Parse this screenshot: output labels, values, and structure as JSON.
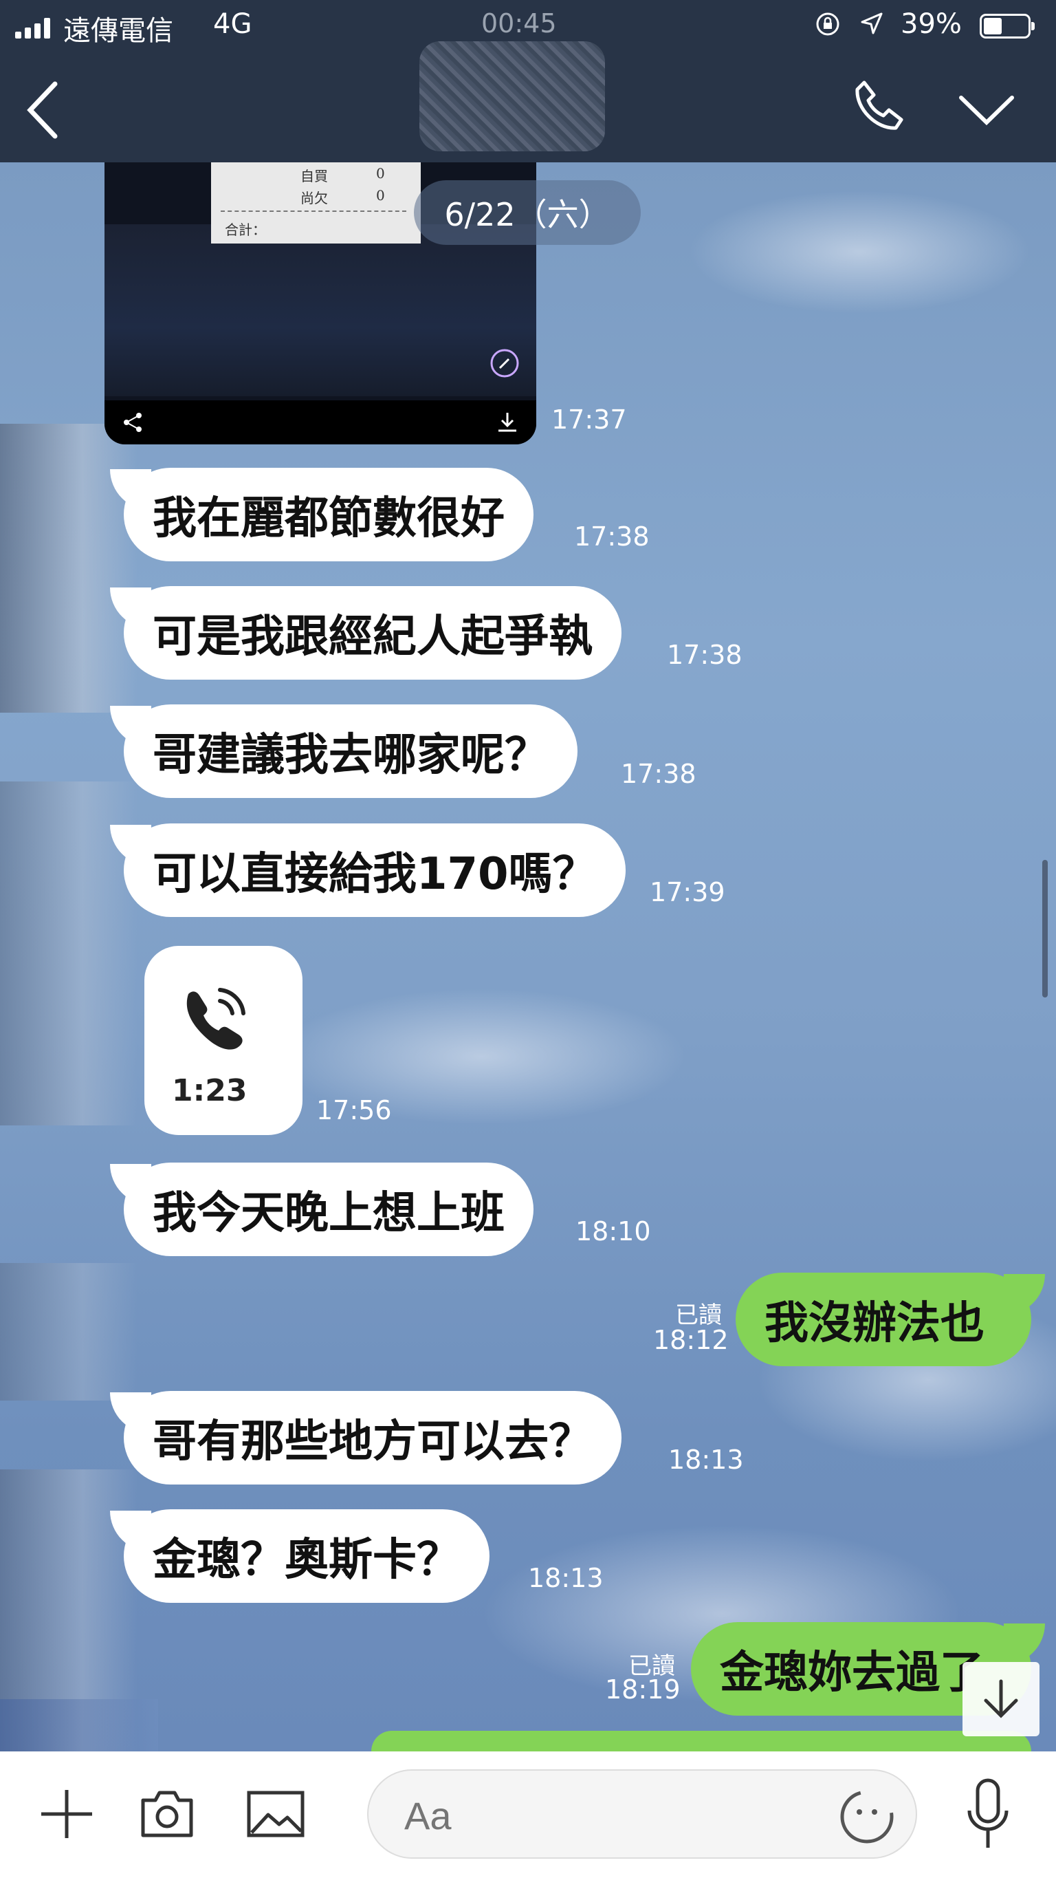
{
  "status_bar": {
    "carrier": "遠傳電信",
    "network": "4G",
    "time": "00:45",
    "battery": "39%"
  },
  "photo_message": {
    "receipt_lines": [
      "自買",
      "0",
      "尚欠",
      "0",
      "合計："
    ],
    "time": "17:37"
  },
  "date_pill": "6/22（六）",
  "messages": [
    {
      "side": "in",
      "text": "我在麗都節數很好",
      "time": "17:38"
    },
    {
      "side": "in",
      "text": "可是我跟經紀人起爭執",
      "time": "17:38"
    },
    {
      "side": "in",
      "text": "哥建議我去哪家呢？",
      "time": "17:38"
    },
    {
      "side": "in",
      "text": "可以直接給我170嗎？",
      "time": "17:39"
    },
    {
      "side": "in",
      "text": "我今天晚上想上班",
      "time": "18:10"
    },
    {
      "side": "out",
      "text": "我沒辦法也",
      "time": "18:12",
      "read": "已讀"
    },
    {
      "side": "in",
      "text": "哥有那些地方可以去？",
      "time": "18:13"
    },
    {
      "side": "in",
      "text": "金璁？奧斯卡？",
      "time": "18:13"
    },
    {
      "side": "out",
      "text": "金璁妳去過了",
      "time": "18:19",
      "read": "已讀"
    }
  ],
  "call_message": {
    "duration": "1:23",
    "time": "17:56"
  },
  "input": {
    "placeholder": "Aa"
  },
  "colors": {
    "header": "#283447",
    "outgoing": "#84d356",
    "incoming": "#ffffff"
  }
}
